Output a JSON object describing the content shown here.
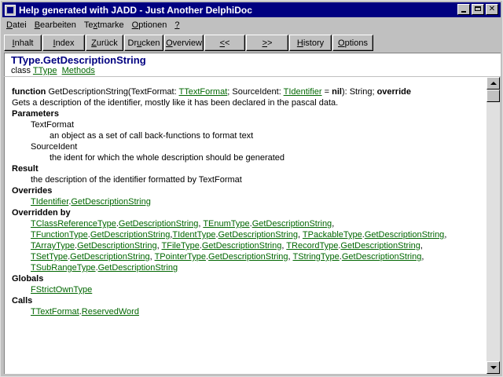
{
  "window": {
    "title": "Help generated with JADD - Just Another DelphiDoc"
  },
  "menu": [
    {
      "pre": "",
      "ul": "D",
      "post": "atei"
    },
    {
      "pre": "",
      "ul": "B",
      "post": "earbeiten"
    },
    {
      "pre": "Te",
      "ul": "x",
      "post": "tmarke"
    },
    {
      "pre": "",
      "ul": "O",
      "post": "ptionen"
    },
    {
      "pre": "",
      "ul": "?",
      "post": ""
    }
  ],
  "toolbar": [
    {
      "pre": "",
      "ul": "I",
      "post": "nhalt"
    },
    {
      "pre": "",
      "ul": "I",
      "post": "ndex"
    },
    {
      "pre": "",
      "ul": "Z",
      "post": "urück"
    },
    {
      "pre": "Dr",
      "ul": "u",
      "post": "cken"
    },
    {
      "pre": "",
      "ul": "O",
      "post": "verview"
    },
    {
      "pre": "",
      "ul": "<",
      "post": "<"
    },
    {
      "pre": "",
      "ul": ">",
      "post": ">"
    },
    {
      "pre": "",
      "ul": "H",
      "post": "istory"
    },
    {
      "pre": "",
      "ul": "O",
      "post": "ptions"
    }
  ],
  "header": {
    "title": "TType.GetDescriptionString",
    "class_label": "class",
    "class_link": "TType",
    "methods_link": "Methods"
  },
  "body": {
    "decl_kw1": "function",
    "decl_name": " GetDescriptionString(TextFormat: ",
    "decl_type1": "TTextFormat",
    "decl_mid": "; SourceIdent: ",
    "decl_type2": "TIdentifier",
    "decl_eq": " = ",
    "decl_nil": "nil",
    "decl_tail": "): String; ",
    "decl_override": "override",
    "summary": "Gets a description of the identifier, mostly like it has been declared in the pascal data.",
    "parameters_heading": "Parameters",
    "param1_name": "TextFormat",
    "param1_desc": "an object as a set of call back-functions to format text",
    "param2_name": "SourceIdent",
    "param2_desc": "the ident for which the whole description should be generated",
    "result_heading": "Result",
    "result_desc": "the description of the identifier formatted by TextFormat",
    "overrides_heading": "Overrides",
    "overrides_class": "TIdentifier",
    "overrides_method": "GetDescriptionString",
    "overridden_heading": "Overridden by",
    "overridden_by": [
      [
        "TClassReferenceType",
        "GetDescriptionString",
        ", "
      ],
      [
        "TEnumType",
        "GetDescriptionString",
        ", "
      ],
      [
        "TFunctionType",
        "GetDescriptionString",
        ","
      ],
      [
        "TIdentType",
        "GetDescriptionString",
        ", "
      ],
      [
        "TPackableType",
        "GetDescriptionString",
        ", "
      ],
      [
        "TArrayType",
        "GetDescriptionString",
        ", "
      ],
      [
        "TFileType",
        "",
        "."
      ],
      [
        "",
        "GetDescriptionString",
        ", "
      ],
      [
        "TRecordType",
        "GetDescriptionString",
        ", "
      ],
      [
        "TSetType",
        "GetDescriptionString",
        ", "
      ],
      [
        "TPointerType",
        "",
        "."
      ],
      [
        "",
        "GetDescriptionString",
        ", "
      ],
      [
        "TStringType",
        "GetDescriptionString",
        ", "
      ],
      [
        "TSubRangeType",
        "GetDescriptionString",
        ""
      ]
    ],
    "globals_heading": "Globals",
    "globals_link": "FStrictOwnType",
    "calls_heading": "Calls",
    "calls_class": "TTextFormat",
    "calls_method": "ReservedWord"
  }
}
